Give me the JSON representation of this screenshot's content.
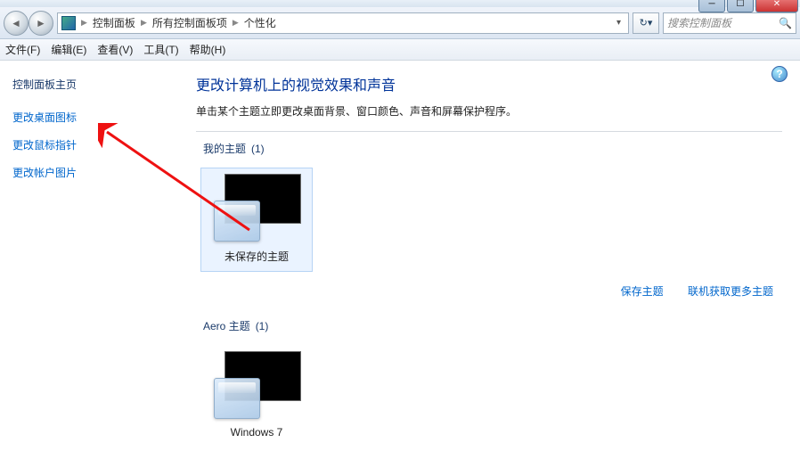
{
  "breadcrumb": {
    "seg1": "控制面板",
    "seg2": "所有控制面板项",
    "seg3": "个性化"
  },
  "search": {
    "placeholder": "搜索控制面板"
  },
  "menu": {
    "file": "文件(F)",
    "edit": "编辑(E)",
    "view": "查看(V)",
    "tools": "工具(T)",
    "help": "帮助(H)"
  },
  "sidebar": {
    "home": "控制面板主页",
    "link1": "更改桌面图标",
    "link2": "更改鼠标指针",
    "link3": "更改帐户图片"
  },
  "page": {
    "title": "更改计算机上的视觉效果和声音",
    "subtitle": "单击某个主题立即更改桌面背景、窗口颜色、声音和屏幕保护程序。"
  },
  "sections": {
    "my_themes": {
      "label": "我的主题",
      "count": "(1)"
    },
    "aero_themes": {
      "label": "Aero 主题",
      "count": "(1)"
    }
  },
  "themes": {
    "unsaved": "未保存的主题",
    "windows7": "Windows 7"
  },
  "actions": {
    "save_theme": "保存主题",
    "more_online": "联机获取更多主题"
  }
}
